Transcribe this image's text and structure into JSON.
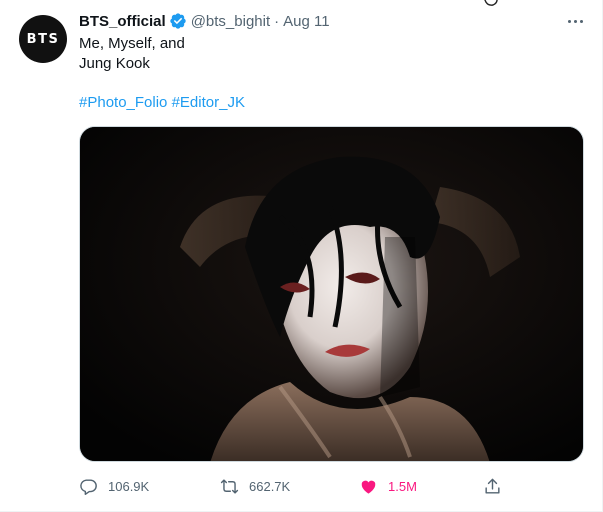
{
  "account": {
    "avatar_text": "BTS",
    "display_name": "BTS_official",
    "verified": true,
    "handle": "@bts_bighit",
    "separator": "·",
    "date": "Aug 11"
  },
  "tweet": {
    "text_lines": [
      "Me, Myself, and",
      "Jung Kook"
    ],
    "hashtags": [
      "#Photo_Folio",
      "#Editor_JK"
    ],
    "media_alt": "photo"
  },
  "actions": {
    "replies": "106.9K",
    "retweets": "662.7K",
    "likes": "1.5M",
    "liked": true
  },
  "colors": {
    "link": "#1d9bf0",
    "like": "#f91880",
    "secondary_text": "#536471",
    "verified": "#1d9bf0"
  },
  "icons": [
    "more-icon",
    "verified-badge-icon",
    "reply-icon",
    "retweet-icon",
    "heart-icon",
    "share-icon"
  ]
}
